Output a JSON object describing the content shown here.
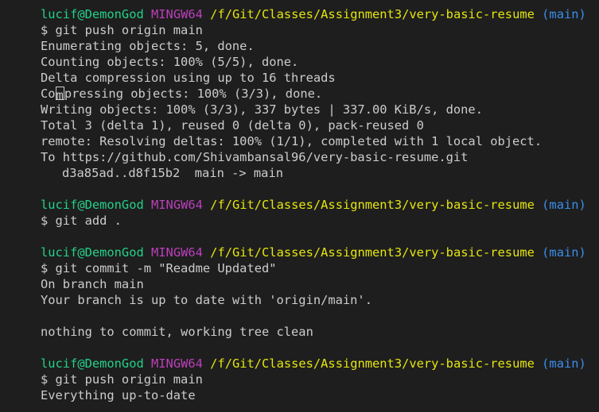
{
  "terminal": {
    "colors": {
      "background": "#1e1e1e",
      "text": "#cccccc",
      "user": "#23d18b",
      "system": "#bc3fbc",
      "path": "#e5e510",
      "branch": "#3b8eea"
    },
    "prompt": {
      "user": "lucif@DemonGod",
      "system": "MINGW64",
      "path": "/f/Git/Classes/Assignment3/very-basic-resume",
      "branch": "(main)"
    },
    "block1": {
      "command": "$ git push origin main",
      "out1": "Enumerating objects: 5, done.",
      "out2": "Counting objects: 100% (5/5), done.",
      "out3": "Delta compression using up to 16 threads",
      "out4_before_cursor": "Co",
      "out4_cursor_char": "m",
      "out4_after_cursor": "pressing objects: 100% (3/3), done.",
      "out5": "Writing objects: 100% (3/3), 337 bytes | 337.00 KiB/s, done.",
      "out6": "Total 3 (delta 1), reused 0 (delta 0), pack-reused 0",
      "out7": "remote: Resolving deltas: 100% (1/1), completed with 1 local object.",
      "out8": "To https://github.com/Shivambansal96/very-basic-resume.git",
      "out9": "d3a85ad..d8f15b2  main -> main"
    },
    "block2": {
      "command": "$ git add ."
    },
    "block3": {
      "command": "$ git commit -m \"Readme Updated\"",
      "out1": "On branch main",
      "out2": "Your branch is up to date with 'origin/main'.",
      "out3": "nothing to commit, working tree clean"
    },
    "block4": {
      "command": "$ git push origin main",
      "out1": "Everything up-to-date"
    }
  }
}
